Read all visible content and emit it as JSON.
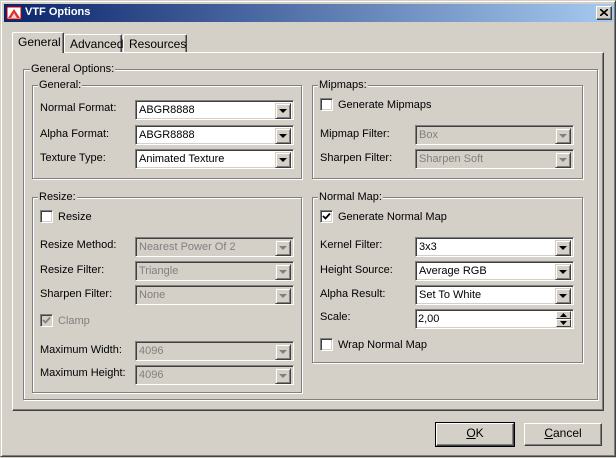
{
  "window": {
    "title": "VTF Options"
  },
  "tabs": [
    {
      "label": "General",
      "active": true
    },
    {
      "label": "Advanced",
      "active": false
    },
    {
      "label": "Resources",
      "active": false
    }
  ],
  "general_options": {
    "legend": "General Options:",
    "general": {
      "legend": "General:",
      "normal_format_label": "Normal Format:",
      "normal_format_value": "ABGR8888",
      "alpha_format_label": "Alpha Format:",
      "alpha_format_value": "ABGR8888",
      "texture_type_label": "Texture Type:",
      "texture_type_value": "Animated Texture"
    },
    "mipmaps": {
      "legend": "Mipmaps:",
      "generate_label": "Generate Mipmaps",
      "generate_checked": false,
      "filter_label": "Mipmap Filter:",
      "filter_value": "Box",
      "sharpen_label": "Sharpen Filter:",
      "sharpen_value": "Sharpen Soft"
    },
    "resize": {
      "legend": "Resize:",
      "resize_label": "Resize",
      "resize_checked": false,
      "method_label": "Resize Method:",
      "method_value": "Nearest Power Of 2",
      "filter_label": "Resize Filter:",
      "filter_value": "Triangle",
      "sharpen_label": "Sharpen Filter:",
      "sharpen_value": "None",
      "clamp_label": "Clamp",
      "clamp_checked": true,
      "max_width_label": "Maximum Width:",
      "max_width_value": "4096",
      "max_height_label": "Maximum Height:",
      "max_height_value": "4096"
    },
    "normal_map": {
      "legend": "Normal Map:",
      "generate_label": "Generate Normal Map",
      "generate_checked": true,
      "kernel_label": "Kernel Filter:",
      "kernel_value": "3x3",
      "height_label": "Height Source:",
      "height_value": "Average RGB",
      "alpha_label": "Alpha Result:",
      "alpha_value": "Set To White",
      "scale_label": "Scale:",
      "scale_value": "2,00",
      "wrap_label": "Wrap Normal Map",
      "wrap_checked": false
    }
  },
  "buttons": {
    "ok_accel": "O",
    "ok_rest": "K",
    "cancel_accel": "C",
    "cancel_rest": "ancel"
  },
  "colors": {
    "titlebar_start": "#0a246a",
    "titlebar_end": "#a6caf0",
    "face": "#d4d0c8"
  }
}
